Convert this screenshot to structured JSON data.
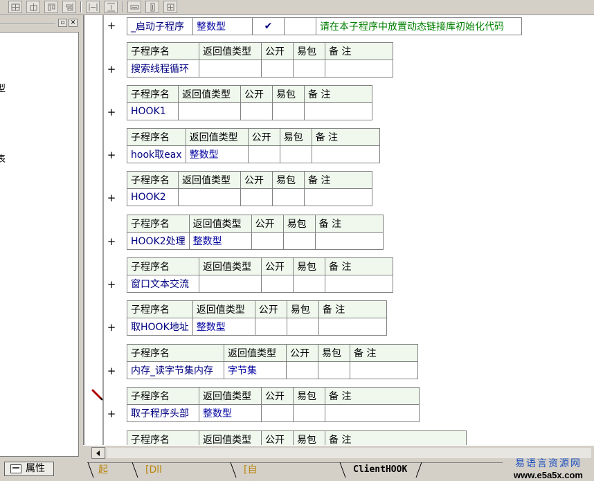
{
  "left_panel": {
    "cut_text_1": "型",
    "cut_text_2": "表"
  },
  "table_headers": {
    "name": "子程序名",
    "return_type": "返回值类型",
    "public": "公开",
    "easy_pack": "易包",
    "remark": "备 注"
  },
  "top_row": {
    "name": "_启动子程序",
    "return_type": "整数型",
    "public_mark": "✔",
    "comment": "请在本子程序中放置动态链接库初始化代码"
  },
  "subroutines": [
    {
      "name": "搜索线程循环",
      "return_type": ""
    },
    {
      "name": "HOOK1",
      "return_type": ""
    },
    {
      "name": "hook取eax",
      "return_type": "整数型"
    },
    {
      "name": "HOOK2",
      "return_type": ""
    },
    {
      "name": "HOOK2处理",
      "return_type": "整数型"
    },
    {
      "name": "窗口文本交流",
      "return_type": ""
    },
    {
      "name": "取HOOK地址",
      "return_type": "整数型"
    },
    {
      "name": "内存_读字节集内存",
      "return_type": "字节集"
    },
    {
      "name": "取子程序头部",
      "return_type": "整数型"
    }
  ],
  "plus_symbol": "+",
  "bottom": {
    "props_button": "属性",
    "tabs": [
      "起始页",
      "[Dll命令定义表]",
      "[自定义数据类型表]",
      "ClientHOOK"
    ],
    "active_tab": "ClientHOOK"
  },
  "watermark": {
    "title": "易语言资源网",
    "url": "www.e5a5x.com"
  }
}
